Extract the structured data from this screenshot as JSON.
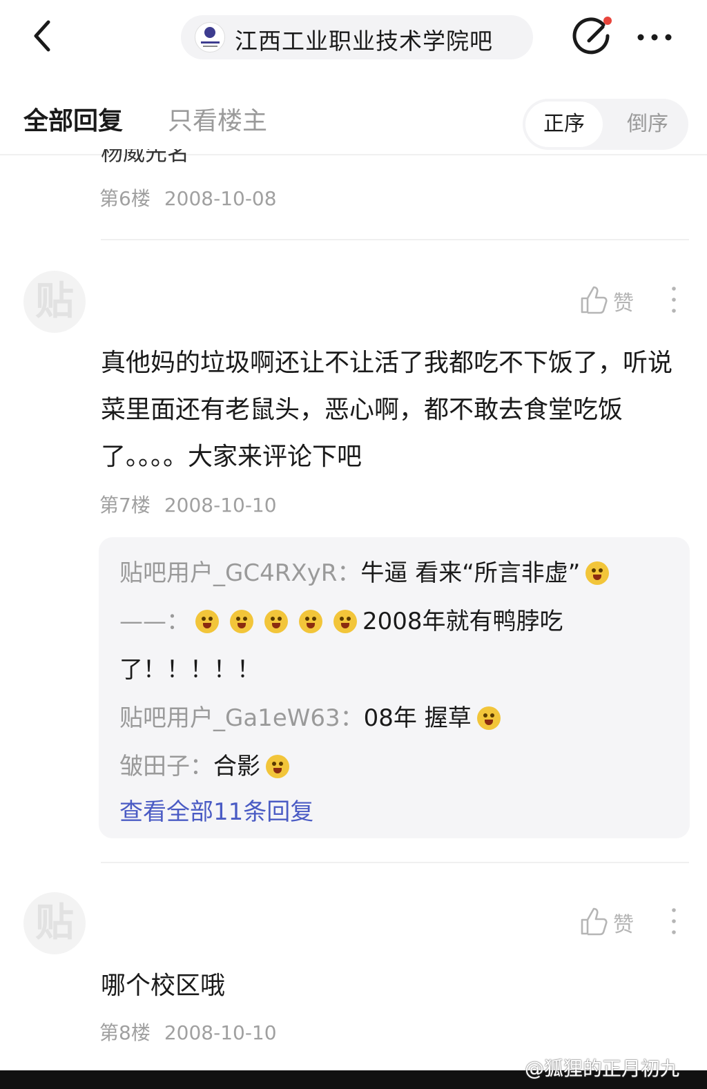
{
  "header": {
    "forum_name": "江西工业职业技术学院吧",
    "badge_color": "#e8453c"
  },
  "tabs": {
    "all_replies": "全部回复",
    "only_op": "只看楼主",
    "sort_asc": "正序",
    "sort_desc": "倒序"
  },
  "posts": [
    {
      "clipped_text": "杨威先名",
      "floor": "第6楼",
      "date": "2008-10-08"
    },
    {
      "avatar_glyph": "贴",
      "like_label": "赞",
      "content": "真他妈的垃圾啊还让不让活了我都吃不下饭了，听说菜里面还有老鼠头，恶心啊，都不敢去食堂吃饭了。。。。大家来评论下吧",
      "floor": "第7楼",
      "date": "2008-10-10",
      "replies": [
        {
          "user": "贴吧用户_GC4RXyR：",
          "text": "牛逼 看来“所言非虚”"
        },
        {
          "user": "",
          "text_a": "——：",
          "text_b": "2008年就有鸭脖吃",
          "text_c": "了！！！！！"
        },
        {
          "user": "贴吧用户_Ga1eW63：",
          "text": "08年 握草"
        },
        {
          "user": "皱田子：",
          "text": "合影"
        }
      ],
      "view_all": "查看全部11条回复"
    },
    {
      "avatar_glyph": "贴",
      "like_label": "赞",
      "content": "哪个校区哦",
      "floor": "第8楼",
      "date": "2008-10-10"
    }
  ],
  "watermark": "@狐狸的正月初九"
}
